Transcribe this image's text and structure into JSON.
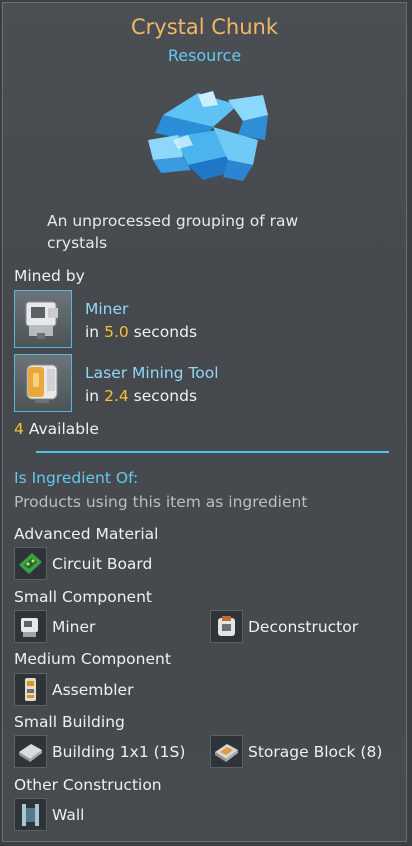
{
  "title": "Crystal Chunk",
  "subtitle": "Resource",
  "description": "An unprocessed grouping of raw crystals",
  "mined_by": {
    "heading": "Mined by",
    "sources": [
      {
        "name": "Miner",
        "time_prefix": "in",
        "time_value": "5.0",
        "time_suffix": "seconds",
        "icon": "miner-icon"
      },
      {
        "name": "Laser Mining Tool",
        "time_prefix": "in",
        "time_value": "2.4",
        "time_suffix": "seconds",
        "icon": "laser-mining-tool-icon"
      }
    ],
    "available_count": "4",
    "available_label": "Available"
  },
  "ingredient": {
    "heading": "Is Ingredient Of:",
    "subheading": "Products using this item as ingredient",
    "categories": [
      {
        "name": "Advanced Material",
        "items": [
          {
            "label": "Circuit Board",
            "icon": "circuit-board-icon"
          }
        ]
      },
      {
        "name": "Small Component",
        "items": [
          {
            "label": "Miner",
            "icon": "miner-icon"
          },
          {
            "label": "Deconstructor",
            "icon": "deconstructor-icon"
          }
        ]
      },
      {
        "name": "Medium Component",
        "items": [
          {
            "label": "Assembler",
            "icon": "assembler-icon"
          }
        ]
      },
      {
        "name": "Small Building",
        "items": [
          {
            "label": "Building 1x1 (1S)",
            "icon": "building-block-icon"
          },
          {
            "label": "Storage Block (8)",
            "icon": "storage-block-icon"
          }
        ]
      },
      {
        "name": "Other Construction",
        "items": [
          {
            "label": "Wall",
            "icon": "wall-icon"
          }
        ]
      }
    ]
  },
  "colors": {
    "title": "#f2b766",
    "accent": "#63c9ef",
    "number": "#f2c238"
  }
}
